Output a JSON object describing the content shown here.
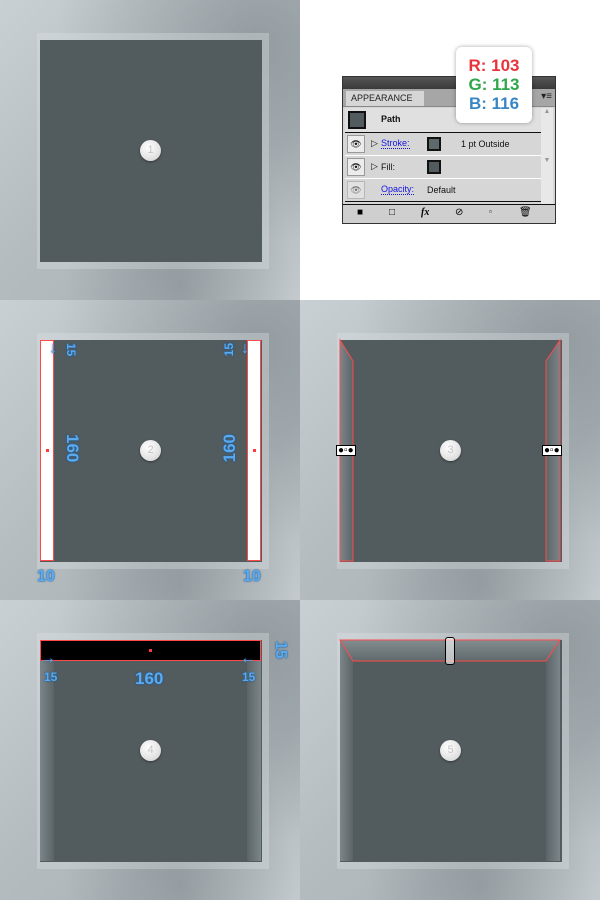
{
  "steps": [
    {
      "number": "1"
    },
    {
      "number": "2",
      "labels": {
        "top_left": "15",
        "top_right": "15",
        "height_left": "160",
        "height_right": "160",
        "width_left": "10",
        "width_right": "10"
      }
    },
    {
      "number": "3"
    },
    {
      "number": "4",
      "labels": {
        "left": "15",
        "right": "15",
        "width": "160",
        "height": "15"
      }
    },
    {
      "number": "5"
    }
  ],
  "colors": {
    "square_fill": "#525b5e",
    "selection": "#ff4a4a",
    "annotation": "#5aaaf0"
  },
  "appearance_panel": {
    "tab": "APPEARANCE",
    "object": "Path",
    "rows": [
      {
        "label": "Stroke:",
        "value": "1 pt  Outside"
      },
      {
        "label": "Fill:",
        "value": ""
      },
      {
        "label": "Opacity:",
        "value": "Default"
      }
    ],
    "title_controls": "◂◂ | ✕",
    "bottom_icons": [
      "new-art-icon",
      "clear-icon",
      "fx-icon",
      "no-icon",
      "duplicate-icon",
      "trash-icon"
    ]
  },
  "rgb_tooltip": {
    "r": "R: 103",
    "g": "G: 113",
    "b": "B: 116",
    "r_color": "#e8333b",
    "g_color": "#2fa64b",
    "b_color": "#3a86c4"
  }
}
